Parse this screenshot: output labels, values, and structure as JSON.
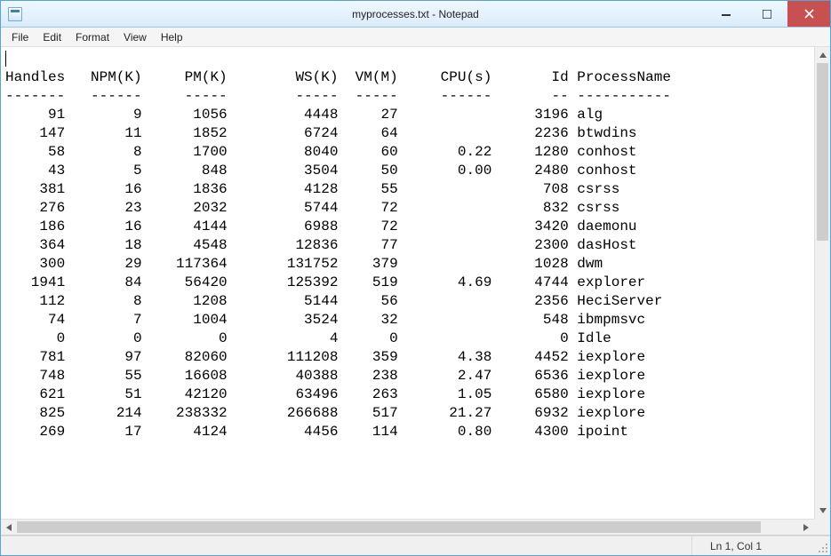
{
  "window": {
    "title": "myprocesses.txt - Notepad"
  },
  "menu": {
    "file": "File",
    "edit": "Edit",
    "format": "Format",
    "view": "View",
    "help": "Help"
  },
  "status": {
    "position": "Ln 1, Col 1"
  },
  "table": {
    "columns": [
      "Handles",
      "NPM(K)",
      "PM(K)",
      "WS(K)",
      "VM(M)",
      "CPU(s)",
      "Id",
      "ProcessName"
    ],
    "rows": [
      {
        "Handles": 91,
        "NPM(K)": 9,
        "PM(K)": 1056,
        "WS(K)": 4448,
        "VM(M)": 27,
        "CPU(s)": "",
        "Id": 3196,
        "ProcessName": "alg"
      },
      {
        "Handles": 147,
        "NPM(K)": 11,
        "PM(K)": 1852,
        "WS(K)": 6724,
        "VM(M)": 64,
        "CPU(s)": "",
        "Id": 2236,
        "ProcessName": "btwdins"
      },
      {
        "Handles": 58,
        "NPM(K)": 8,
        "PM(K)": 1700,
        "WS(K)": 8040,
        "VM(M)": 60,
        "CPU(s)": "0.22",
        "Id": 1280,
        "ProcessName": "conhost"
      },
      {
        "Handles": 43,
        "NPM(K)": 5,
        "PM(K)": 848,
        "WS(K)": 3504,
        "VM(M)": 50,
        "CPU(s)": "0.00",
        "Id": 2480,
        "ProcessName": "conhost"
      },
      {
        "Handles": 381,
        "NPM(K)": 16,
        "PM(K)": 1836,
        "WS(K)": 4128,
        "VM(M)": 55,
        "CPU(s)": "",
        "Id": 708,
        "ProcessName": "csrss"
      },
      {
        "Handles": 276,
        "NPM(K)": 23,
        "PM(K)": 2032,
        "WS(K)": 5744,
        "VM(M)": 72,
        "CPU(s)": "",
        "Id": 832,
        "ProcessName": "csrss"
      },
      {
        "Handles": 186,
        "NPM(K)": 16,
        "PM(K)": 4144,
        "WS(K)": 6988,
        "VM(M)": 72,
        "CPU(s)": "",
        "Id": 3420,
        "ProcessName": "daemonu"
      },
      {
        "Handles": 364,
        "NPM(K)": 18,
        "PM(K)": 4548,
        "WS(K)": 12836,
        "VM(M)": 77,
        "CPU(s)": "",
        "Id": 2300,
        "ProcessName": "dasHost"
      },
      {
        "Handles": 300,
        "NPM(K)": 29,
        "PM(K)": 117364,
        "WS(K)": 131752,
        "VM(M)": 379,
        "CPU(s)": "",
        "Id": 1028,
        "ProcessName": "dwm"
      },
      {
        "Handles": 1941,
        "NPM(K)": 84,
        "PM(K)": 56420,
        "WS(K)": 125392,
        "VM(M)": 519,
        "CPU(s)": "4.69",
        "Id": 4744,
        "ProcessName": "explorer"
      },
      {
        "Handles": 112,
        "NPM(K)": 8,
        "PM(K)": 1208,
        "WS(K)": 5144,
        "VM(M)": 56,
        "CPU(s)": "",
        "Id": 2356,
        "ProcessName": "HeciServer"
      },
      {
        "Handles": 74,
        "NPM(K)": 7,
        "PM(K)": 1004,
        "WS(K)": 3524,
        "VM(M)": 32,
        "CPU(s)": "",
        "Id": 548,
        "ProcessName": "ibmpmsvc"
      },
      {
        "Handles": 0,
        "NPM(K)": 0,
        "PM(K)": 0,
        "WS(K)": 4,
        "VM(M)": 0,
        "CPU(s)": "",
        "Id": 0,
        "ProcessName": "Idle"
      },
      {
        "Handles": 781,
        "NPM(K)": 97,
        "PM(K)": 82060,
        "WS(K)": 111208,
        "VM(M)": 359,
        "CPU(s)": "4.38",
        "Id": 4452,
        "ProcessName": "iexplore"
      },
      {
        "Handles": 748,
        "NPM(K)": 55,
        "PM(K)": 16608,
        "WS(K)": 40388,
        "VM(M)": 238,
        "CPU(s)": "2.47",
        "Id": 6536,
        "ProcessName": "iexplore"
      },
      {
        "Handles": 621,
        "NPM(K)": 51,
        "PM(K)": 42120,
        "WS(K)": 63496,
        "VM(M)": 263,
        "CPU(s)": "1.05",
        "Id": 6580,
        "ProcessName": "iexplore"
      },
      {
        "Handles": 825,
        "NPM(K)": 214,
        "PM(K)": 238332,
        "WS(K)": 266688,
        "VM(M)": 517,
        "CPU(s)": "21.27",
        "Id": 6932,
        "ProcessName": "iexplore"
      },
      {
        "Handles": 269,
        "NPM(K)": 17,
        "PM(K)": 4124,
        "WS(K)": 4456,
        "VM(M)": 114,
        "CPU(s)": "0.80",
        "Id": 4300,
        "ProcessName": "ipoint"
      }
    ]
  },
  "col_widths": {
    "Handles": 7,
    "NPM(K)": 7,
    "PM(K)": 8,
    "WS(K)": 10,
    "VM(M)": 6,
    "CPU(s)": 9,
    "Id": 8
  },
  "col_gaps": {
    "Handles": "",
    "NPM(K)": "  ",
    "PM(K)": "  ",
    "WS(K)": "   ",
    "VM(M)": " ",
    "CPU(s)": "  ",
    "Id": " ",
    "ProcessName": " "
  }
}
